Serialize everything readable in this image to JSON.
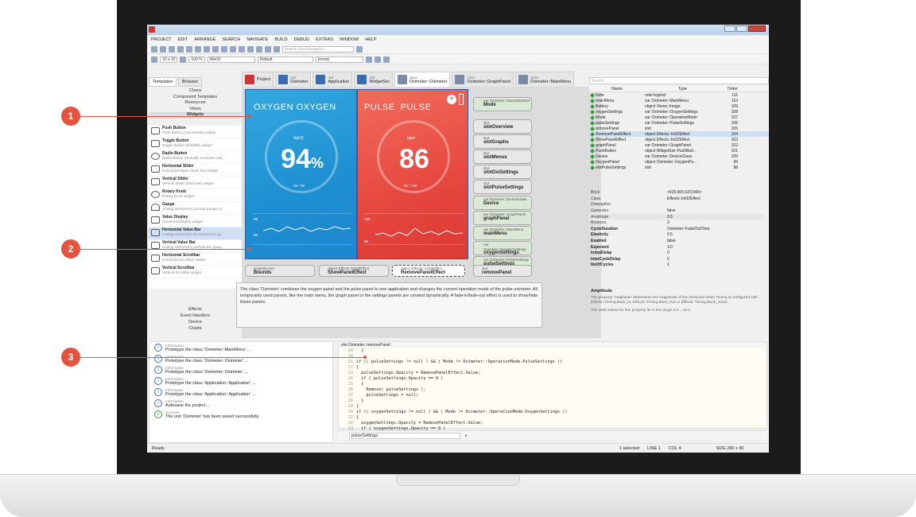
{
  "menu": [
    "PROJECT",
    "EDIT",
    "ARRANGE",
    "SEARCH",
    "NAVIGATE",
    "BUILD",
    "DEBUG",
    "EXTRAS",
    "WINDOW",
    "HELP"
  ],
  "toolbar": {
    "search_placeholder": "Search Documentation ...",
    "grid": "10 x 10",
    "zoom": "100 %",
    "platform": "Win32",
    "profile": "Default",
    "scope": "(none)"
  },
  "left": {
    "tabs": [
      "Templates",
      "Browser"
    ],
    "categories_top": [
      "Chora",
      "Component Templates",
      "Resources",
      "Views",
      "Widgets"
    ],
    "widgets": [
      {
        "name": "Push Button",
        "desc": "Push Button (monostable) widget"
      },
      {
        "name": "Toggle Button",
        "desc": "Toggle Button (bistable) widget"
      },
      {
        "name": "Radio Button",
        "desc": "Radio Button (mutually exclusive opti..."
      },
      {
        "name": "Horizontal Slider",
        "desc": "Horizontal Slider (track bar) widget"
      },
      {
        "name": "Vertical Slider",
        "desc": "Vertical Slider (track bar) widget"
      },
      {
        "name": "Rotary Knob",
        "desc": "Rotary Knob widget"
      },
      {
        "name": "Gauge",
        "desc": "Analog instrument (circular gauge) w..."
      },
      {
        "name": "Value Display",
        "desc": "Numerical display widget"
      },
      {
        "name": "Horizontal Value Bar",
        "desc": "Analog instrument (horizontal bar ga..."
      },
      {
        "name": "Vertical Value Bar",
        "desc": "Analog instrument (vertical bar gaug..."
      },
      {
        "name": "Horizontal Scrollbar",
        "desc": "Horizontal Scrollbar widget"
      },
      {
        "name": "Vertical Scrollbar",
        "desc": "Vertical Scrollbar widget"
      }
    ],
    "categories_bottom": [
      "Effects",
      "Event Handlers",
      "Device",
      "Charts"
    ]
  },
  "tabs": [
    {
      "sub": "",
      "label": "Project"
    },
    {
      "sub": "unit",
      "label": "Oximeter"
    },
    {
      "sub": "unit",
      "label": "Application"
    },
    {
      "sub": "unit",
      "label": "WidgetSet"
    },
    {
      "sub": "class",
      "label": "Oximeter::Oximeter"
    },
    {
      "sub": "class",
      "label": "Oximeter::GraphPanel"
    },
    {
      "sub": "class",
      "label": "Oximeter::MainMenu"
    }
  ],
  "oxygen": {
    "title": "OXYGEN",
    "unit": "SpO2",
    "value": "94",
    "percent": "%",
    "range": "85 / 99",
    "g1": "99",
    "g2": "85"
  },
  "pulse": {
    "title": "PULSE",
    "unit": "bpm",
    "value": "86",
    "range": "50 / 130",
    "g1": "130",
    "g2": "50"
  },
  "slots": [
    {
      "type": "var Oximeter::OperationMod",
      "name": "Mode"
    },
    {
      "type": "slot",
      "name": "slotOverview"
    },
    {
      "type": "slot",
      "name": "slotGraphs"
    },
    {
      "type": "slot",
      "name": "slotMenus"
    },
    {
      "type": "slot",
      "name": "slotOxiSettings"
    },
    {
      "type": "slot",
      "name": "slotPulseSettings"
    },
    {
      "type": "var Oximeter::DeviceClass",
      "name": "Device"
    },
    {
      "type": "var Oximeter::GraphPanel",
      "name": "graphPanel"
    },
    {
      "type": "var Oximeter::MainMenu",
      "name": "mainMenu"
    },
    {
      "type": "var Oximeter::OxygenSettings",
      "name": "oxygenSettings"
    },
    {
      "type": "var Oximeter::PulseSettings",
      "name": "pulseSettings"
    }
  ],
  "bottom_slots": [
    {
      "type": "property rect",
      "name": "Bounds"
    },
    {
      "type": "object Effects::Int32Effect",
      "name": "ShowPanelEffect"
    },
    {
      "type": "object Effects::Int32Effect",
      "name": "RemovePanelEffect"
    },
    {
      "type": "slot",
      "name": "removePanel"
    }
  ],
  "note": "The class 'Oximeter' combines the oxygen panel and the pulse panel to one application and changes the current operation mode of the pulse oximeter. All temporarily used panels, like the main menu, the graph panel or the settings panels are created dynamically. A fade-in/fade-out effect is used to show/hide these panels.",
  "members": {
    "search_placeholder": "Search ...",
    "headers": [
      "Name",
      "Type",
      "Order"
    ],
    "rows": [
      [
        "Note",
        "note legend",
        "111"
      ],
      [
        "mainMenu",
        "var Oximeter::MainMenu",
        "110"
      ],
      [
        "Battery",
        "object Views::Image",
        "109"
      ],
      [
        "oxygenSettings",
        "var Oximeter::OxygenSettings",
        "108"
      ],
      [
        "Mode",
        "var Oximeter::OperationMode",
        "107"
      ],
      [
        "pulseSettings",
        "var Oximeter::PulseSettings",
        "106"
      ],
      [
        "removePanel",
        "slot",
        "105"
      ],
      [
        "RemovePanelEffect",
        "object Effects::Int32Effect",
        "104"
      ],
      [
        "ShowPanelEffect",
        "object Effects::Int32Effect",
        "103"
      ],
      [
        "graphPanel",
        "var Oximeter::GraphPanel",
        "102"
      ],
      [
        "PushButton",
        "object WidgetSet::PushButt...",
        "101"
      ],
      [
        "Device",
        "var Oximeter::DeviceClass",
        "100"
      ],
      [
        "OxygenPanel",
        "object Oximeter::OxygenPa...",
        "99"
      ],
      [
        "slotPulseSettings",
        "slot",
        "98"
      ]
    ]
  },
  "props": [
    [
      "Brick",
      "<420,500,620,540>"
    ],
    [
      "Class",
      "Effects::Int32Effect"
    ],
    [
      "Description",
      ""
    ],
    [
      "Generator",
      "false"
    ],
    [
      "Amplitude",
      "0.5"
    ],
    [
      "Bounces",
      "3"
    ],
    [
      "CycleDuration",
      "Oximeter::FadeOutTime"
    ],
    [
      "Elasticity",
      "0.5"
    ],
    [
      "Enabled",
      "false"
    ],
    [
      "Exponent",
      "3.0"
    ],
    [
      "InitialDelay",
      "0"
    ],
    [
      "InterCycleDelay",
      "0"
    ],
    [
      "NoOfCycles",
      "1"
    ]
  ],
  "help": {
    "title": "Amplitude",
    "text": "The property 'Amplitude' determines the magnitude of the retraction when Timing is configured with Effects::Timing.Back_In, Effects::Timing.Back_Out or Effects::Timing.Back_InOut.",
    "range": "The valid values for this property lie in the range 0.0 .. 10.0."
  },
  "messages": [
    {
      "level": "Information",
      "text": "Prototype the class 'Oximeter::MainMenu' ..."
    },
    {
      "level": "Information",
      "text": "Prototype the class 'Oximeter::Oximeter' ..."
    },
    {
      "level": "Information",
      "text": "Prototype the class 'Oximeter::Oximeter' ..."
    },
    {
      "level": "Information",
      "text": "Prototype the class 'Application::Application' ..."
    },
    {
      "level": "Information",
      "text": "Prototype the class 'Application::Application' ..."
    },
    {
      "level": "Information",
      "text": "Autosave the project ..."
    },
    {
      "level": "Success",
      "text": "The unit 'Oximeter' has been saved successfully."
    }
  ],
  "code": {
    "title": "slot Oximeter::removePanel",
    "lines": [
      [
        "19",
        "  }"
      ],
      [
        "20",
        ""
      ],
      [
        "21",
        "if (( pulseSettings != null ) && ( Mode != Oximeter::OperationMode.PulseSettings ))"
      ],
      [
        "22",
        "{"
      ],
      [
        "23",
        "  pulseSettings.Opacity = RemovePanelEffect.Value;"
      ],
      [
        "24",
        "  if ( pulseSettings.Opacity == 0 )"
      ],
      [
        "25",
        "  {"
      ],
      [
        "26",
        "    Remove( pulseSettings );"
      ],
      [
        "27",
        "    pulseSettings = null;"
      ],
      [
        "28",
        "  }"
      ],
      [
        "29",
        "}"
      ],
      [
        "30",
        "if (( oxygenSettings != null ) && ( Mode != Oximeter::OperationMode.OxygenSettings ))"
      ],
      [
        "31",
        "{"
      ],
      [
        "32",
        "  oxygenSettings.Opacity = RemovePanelEffect.Value;"
      ],
      [
        "33",
        "  if ( oxygenSettings.Opacity == 0 )"
      ]
    ],
    "search": "pulseSettings"
  },
  "status": {
    "ready": "Ready",
    "selected": "1 selected",
    "line": "LINE 1",
    "col": "COL 4",
    "size": "SIZE 280 x 40"
  },
  "callouts": [
    "1",
    "2",
    "3"
  ]
}
